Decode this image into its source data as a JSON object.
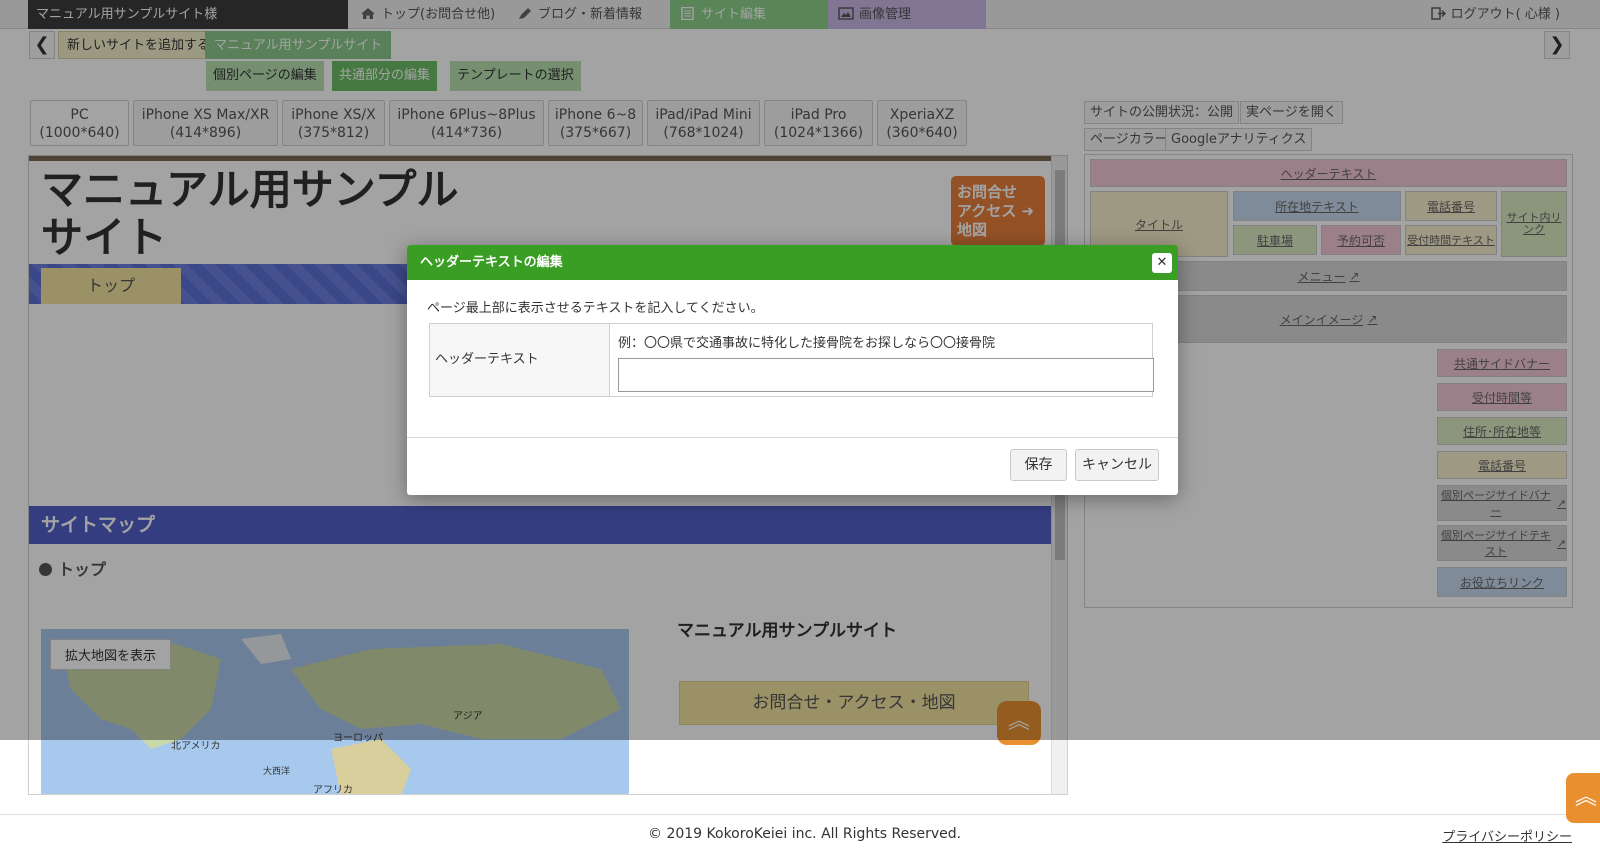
{
  "topbar": {
    "site_name": "マニュアル用サンプルサイト様",
    "nav": [
      {
        "label": "トップ(お問合せ他)",
        "icon": "home-icon"
      },
      {
        "label": "ブログ・新着情報",
        "icon": "pen-icon"
      },
      {
        "label": "サイト編集",
        "icon": "document-icon"
      },
      {
        "label": "画像管理",
        "icon": "image-icon"
      }
    ],
    "logout": "ログアウト( 心様 )"
  },
  "secondbar": {
    "prev": "❮",
    "next": "❯",
    "add_site": "新しいサイトを追加する",
    "current_site": "マニュアル用サンプルサイト",
    "subtabs": [
      "個別ページの編集",
      "共通部分の編集",
      "テンプレートの選択"
    ]
  },
  "devices": [
    {
      "name": "PC",
      "size": "(1000*640)"
    },
    {
      "name": "iPhone XS Max/XR",
      "size": "(414*896)"
    },
    {
      "name": "iPhone XS/X",
      "size": "(375*812)"
    },
    {
      "name": "iPhone 6Plus~8Plus",
      "size": "(414*736)"
    },
    {
      "name": "iPhone 6~8",
      "size": "(375*667)"
    },
    {
      "name": "iPad/iPad Mini",
      "size": "(768*1024)"
    },
    {
      "name": "iPad Pro",
      "size": "(1024*1366)"
    },
    {
      "name": "XperiaXZ",
      "size": "(360*640)"
    }
  ],
  "preview": {
    "title_line1": "マニュアル用サンプル",
    "title_line2": "サイト",
    "contact_lines": [
      "お問合せ",
      "アクセス",
      "地図"
    ],
    "nav_top": "トップ",
    "sitemap_heading": "サイトマップ",
    "sitemap_link": "トップ",
    "map_button": "拡大地図を表示",
    "map_labels": [
      "北アメリカ",
      "ヨーロッパ",
      "アジア",
      "大西洋",
      "アフリカ"
    ],
    "info_title": "マニュアル用サンプルサイト",
    "info_button": "お問合せ・アクセス・地図"
  },
  "right_panel": {
    "publish_status": "サイトの公開状況：公開",
    "open_page": "実ページを開く",
    "page_color": "ページカラー",
    "analytics": "Googleアナリティクス",
    "blocks": {
      "header_text": "ヘッダーテキスト",
      "title": "タイトル",
      "address_text": "所在地テキスト",
      "phone": "電話番号",
      "site_link": "サイト内リンク",
      "parking": "駐車場",
      "reservation": "予約可否",
      "hours_text": "受付時間テキスト",
      "menu": "メニュー",
      "main_image": "メインイメージ",
      "common_side_banner": "共通サイドバナー",
      "reception_hours": "受付時間等",
      "address": "住所･所在地等",
      "phone2": "電話番号",
      "page_side_banner": "個別ページサイドバナー",
      "page_side_text": "個別ページサイドテキスト",
      "useful_links": "お役立ちリンク"
    }
  },
  "modal": {
    "title": "ヘッダーテキストの編集",
    "close": "✕",
    "description": "ページ最上部に表示させるテキストを記入してください。",
    "field_label": "ヘッダーテキスト",
    "example": "例：〇〇県で交通事故に特化した接骨院をお探しなら〇〇接骨院",
    "input_value": "",
    "save": "保存",
    "cancel": "キャンセル"
  },
  "footer": {
    "copyright": "© 2019 KokoroKeiei inc. All Rights Reserved.",
    "privacy": "プライバシーポリシー"
  },
  "colors": {
    "modal_header": "#3a9d24",
    "sitemap_band": "#5060c8",
    "contact_orange": "#e87f3c"
  }
}
